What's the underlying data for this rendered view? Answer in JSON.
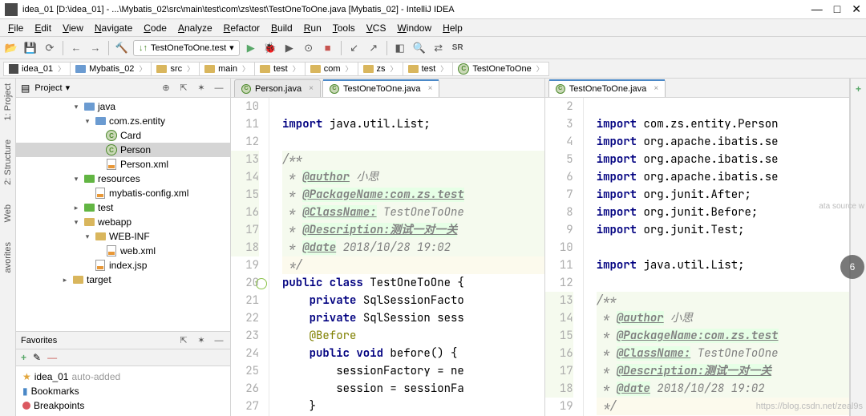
{
  "window": {
    "title": "idea_01 [D:\\idea_01] - ...\\Mybatis_02\\src\\main\\test\\com\\zs\\test\\TestOneToOne.java [Mybatis_02] - IntelliJ IDEA"
  },
  "menu": [
    "File",
    "Edit",
    "View",
    "Navigate",
    "Code",
    "Analyze",
    "Refactor",
    "Build",
    "Run",
    "Tools",
    "VCS",
    "Window",
    "Help"
  ],
  "toolbar": {
    "run_config": "TestOneToOne.test",
    "sr": "SR"
  },
  "breadcrumbs": [
    "idea_01",
    "Mybatis_02",
    "src",
    "main",
    "test",
    "com",
    "zs",
    "test",
    "TestOneToOne"
  ],
  "project": {
    "panel_title": "Project",
    "tree": [
      {
        "depth": 5,
        "tw": "v",
        "icon": "folder-blue",
        "label": "java"
      },
      {
        "depth": 6,
        "tw": "v",
        "icon": "folder-blue",
        "label": "com.zs.entity"
      },
      {
        "depth": 7,
        "tw": "",
        "icon": "class",
        "label": "Card"
      },
      {
        "depth": 7,
        "tw": "",
        "icon": "class",
        "label": "Person",
        "sel": true
      },
      {
        "depth": 7,
        "tw": "",
        "icon": "xml",
        "label": "Person.xml"
      },
      {
        "depth": 5,
        "tw": "v",
        "icon": "folder-green",
        "label": "resources"
      },
      {
        "depth": 6,
        "tw": "",
        "icon": "xml",
        "label": "mybatis-config.xml"
      },
      {
        "depth": 5,
        "tw": ">",
        "icon": "folder-green",
        "label": "test"
      },
      {
        "depth": 5,
        "tw": "v",
        "icon": "folder",
        "label": "webapp"
      },
      {
        "depth": 6,
        "tw": "v",
        "icon": "folder",
        "label": "WEB-INF"
      },
      {
        "depth": 7,
        "tw": "",
        "icon": "xml",
        "label": "web.xml"
      },
      {
        "depth": 6,
        "tw": "",
        "icon": "xml",
        "label": "index.jsp"
      },
      {
        "depth": 4,
        "tw": ">",
        "icon": "folder",
        "label": "target"
      }
    ]
  },
  "favorites": {
    "title": "Favorites",
    "items": [
      {
        "icon": "star",
        "label": "idea_01",
        "suffix": "auto-added"
      },
      {
        "icon": "bookmark",
        "label": "Bookmarks"
      },
      {
        "icon": "breakpoint",
        "label": "Breakpoints"
      }
    ]
  },
  "sidebar_tabs": [
    "1: Project",
    "2: Structure",
    "Web",
    "avorites"
  ],
  "editors": {
    "left": {
      "tabs": [
        {
          "label": "Person.java"
        },
        {
          "label": "TestOneToOne.java",
          "active": true
        }
      ],
      "gutter_start": 10,
      "lines": [
        {
          "n": 10,
          "cls": "",
          "html": ""
        },
        {
          "n": 11,
          "cls": "",
          "html": "<span class='kw'>import</span> java.util.List;"
        },
        {
          "n": 12,
          "cls": "",
          "html": ""
        },
        {
          "n": 13,
          "cls": "doc",
          "html": "<span class='doc-c'>/**</span>"
        },
        {
          "n": 14,
          "cls": "doc",
          "html": "<span class='doc-c'> * </span><span class='doc-tag'>@author</span><span class='doc-txt'> 小思</span>"
        },
        {
          "n": 15,
          "cls": "doc",
          "html": "<span class='doc-c'> * </span><span class='doc-tag'>@PackageName:com.zs.test</span>"
        },
        {
          "n": 16,
          "cls": "doc",
          "html": "<span class='doc-c'> * </span><span class='doc-tag'>@ClassName:</span><span class='doc-txt'> TestOneToOne</span>"
        },
        {
          "n": 17,
          "cls": "doc",
          "html": "<span class='doc-c'> * </span><span class='doc-tag'>@Description:测试一对一关</span>"
        },
        {
          "n": 18,
          "cls": "doc",
          "html": "<span class='doc-c'> * </span><span class='doc-tag'>@date</span><span class='doc-txt'> 2018/10/28 19:02</span>"
        },
        {
          "n": 19,
          "cls": "cur",
          "html": "<span class='doc-c'> */</span>"
        },
        {
          "n": 20,
          "cls": "",
          "circ": true,
          "html": "<span class='kw'>public class</span> TestOneToOne {"
        },
        {
          "n": 21,
          "cls": "",
          "html": "    <span class='kw'>private</span> SqlSessionFacto"
        },
        {
          "n": 22,
          "cls": "",
          "html": "    <span class='kw'>private</span> SqlSession sess"
        },
        {
          "n": 23,
          "cls": "",
          "html": "    <span class='ann'>@Before</span>"
        },
        {
          "n": 24,
          "cls": "",
          "html": "    <span class='kw'>public void</span> before() {"
        },
        {
          "n": 25,
          "cls": "",
          "html": "        sessionFactory = ne"
        },
        {
          "n": 26,
          "cls": "",
          "html": "        session = sessionFa"
        },
        {
          "n": 27,
          "cls": "",
          "html": "    }"
        }
      ]
    },
    "right": {
      "tabs": [
        {
          "label": "TestOneToOne.java",
          "active": true
        }
      ],
      "lines": [
        {
          "n": 2,
          "cls": "",
          "html": ""
        },
        {
          "n": 3,
          "cls": "",
          "html": "<span class='kw'>import</span> com.zs.entity.Person"
        },
        {
          "n": 4,
          "cls": "",
          "html": "<span class='kw'>import</span> org.apache.ibatis.se"
        },
        {
          "n": 5,
          "cls": "",
          "html": "<span class='kw'>import</span> org.apache.ibatis.se"
        },
        {
          "n": 6,
          "cls": "",
          "html": "<span class='kw'>import</span> org.apache.ibatis.se"
        },
        {
          "n": 7,
          "cls": "",
          "html": "<span class='kw'>import</span> org.junit.After;"
        },
        {
          "n": 8,
          "cls": "",
          "html": "<span class='kw'>import</span> org.junit.Before;"
        },
        {
          "n": 9,
          "cls": "",
          "html": "<span class='kw'>import</span> org.junit.Test;"
        },
        {
          "n": 10,
          "cls": "",
          "html": ""
        },
        {
          "n": 11,
          "cls": "",
          "html": "<span class='kw'>import</span> java.util.List;"
        },
        {
          "n": 12,
          "cls": "",
          "html": ""
        },
        {
          "n": 13,
          "cls": "doc",
          "html": "<span class='doc-c'>/**</span>"
        },
        {
          "n": 14,
          "cls": "doc",
          "html": "<span class='doc-c'> * </span><span class='doc-tag'>@author</span><span class='doc-txt'> 小思</span>"
        },
        {
          "n": 15,
          "cls": "doc",
          "html": "<span class='doc-c'> * </span><span class='doc-tag'>@PackageName:com.zs.test</span>"
        },
        {
          "n": 16,
          "cls": "doc",
          "html": "<span class='doc-c'> * </span><span class='doc-tag'>@ClassName:</span><span class='doc-txt'> TestOneToOne</span>"
        },
        {
          "n": 17,
          "cls": "doc",
          "html": "<span class='doc-c'> * </span><span class='doc-tag'>@Description:测试一对一关</span>"
        },
        {
          "n": 18,
          "cls": "doc",
          "html": "<span class='doc-c'> * </span><span class='doc-tag'>@date</span><span class='doc-txt'> 2018/10/28 19:02</span>"
        },
        {
          "n": 19,
          "cls": "cur",
          "html": "<span class='doc-c'> */</span>"
        }
      ]
    }
  },
  "misc": {
    "data_source_hint": "ata source w",
    "badge": "6",
    "watermark": "https://blog.csdn.net/zeal9s"
  },
  "rightbar": {
    "plus": "+"
  }
}
